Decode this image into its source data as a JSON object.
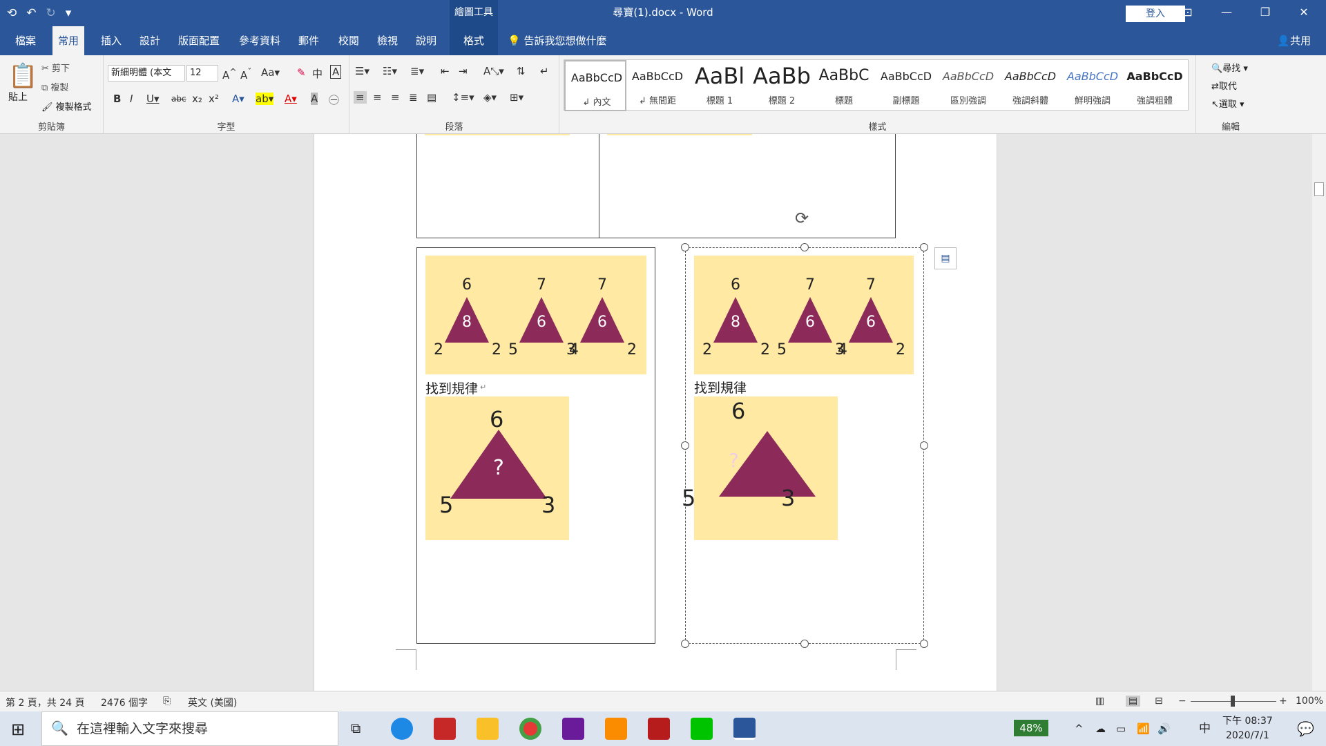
{
  "titlebar": {
    "title": "尋寶(1).docx  -  Word",
    "context_group": "繪圖工具",
    "login": "登入",
    "qat": {
      "save": "⟲",
      "undo": "↶",
      "redo": "↻",
      "customize": "▾"
    },
    "win": {
      "display": "⊡",
      "minimize": "—",
      "restore": "❐",
      "close": "✕"
    }
  },
  "tabs": [
    "檔案",
    "常用",
    "插入",
    "設計",
    "版面配置",
    "參考資料",
    "郵件",
    "校閱",
    "檢視",
    "說明",
    "格式"
  ],
  "tell_me": "告訴我您想做什麼",
  "share": "共用",
  "clipboard": {
    "paste": "貼上",
    "cut": "剪下",
    "copy": "複製",
    "format_painter": "複製格式",
    "group": "剪貼簿"
  },
  "font": {
    "name": "新細明體 (本文",
    "size": "12",
    "group": "字型"
  },
  "paragraph": {
    "group": "段落"
  },
  "styles": {
    "group": "樣式",
    "items": [
      {
        "preview": "AaBbCcD",
        "name": "↲ 內文"
      },
      {
        "preview": "AaBbCcD",
        "name": "↲ 無間距"
      },
      {
        "preview": "AaBl",
        "name": "標題 1"
      },
      {
        "preview": "AaBb",
        "name": "標題 2"
      },
      {
        "preview": "AaBbC",
        "name": "標題"
      },
      {
        "preview": "AaBbCcD",
        "name": "副標題"
      },
      {
        "preview": "AaBbCcD",
        "name": "區別強調"
      },
      {
        "preview": "AaBbCcD",
        "name": "強調斜體"
      },
      {
        "preview": "AaBbCcD",
        "name": "鮮明強調"
      },
      {
        "preview": "AaBbCcD",
        "name": "強調粗體"
      }
    ]
  },
  "editing": {
    "find": "尋找",
    "replace": "取代",
    "select": "選取",
    "group": "編輯"
  },
  "doc": {
    "left": {
      "top_row": [
        {
          "apex": "6",
          "inner": "8",
          "bl": "2",
          "br": "2"
        },
        {
          "apex": "7",
          "inner": "6",
          "bl": "5",
          "br": "3"
        },
        {
          "apex": "7",
          "inner": "6",
          "bl": "4",
          "br": "2"
        }
      ],
      "caption": "找到規律",
      "puzzle": {
        "apex": "6",
        "inner": "?",
        "bl": "5",
        "br": "3"
      }
    },
    "right": {
      "top_row": [
        {
          "apex": "6",
          "inner": "8",
          "bl": "2",
          "br": "2"
        },
        {
          "apex": "7",
          "inner": "6",
          "bl": "5",
          "br": "3"
        },
        {
          "apex": "7",
          "inner": "6",
          "bl": "4",
          "br": "2"
        }
      ],
      "caption": "找到規律",
      "puzzle": {
        "apex": "6",
        "inner": "?",
        "bl": "5",
        "br": "3"
      }
    }
  },
  "colors": {
    "accent": "#2b579a",
    "triangle": "#8c2a5a",
    "tan": "#ffe9a3"
  },
  "status": {
    "page": "第 2 頁，共 24 頁",
    "words": "2476 個字",
    "lang": "英文 (美國)",
    "zoom": "100%"
  },
  "taskbar": {
    "search": "在這裡輸入文字來搜尋",
    "battery": "48%",
    "ime": "中",
    "time": "下午 08:37",
    "date": "2020/7/1"
  }
}
